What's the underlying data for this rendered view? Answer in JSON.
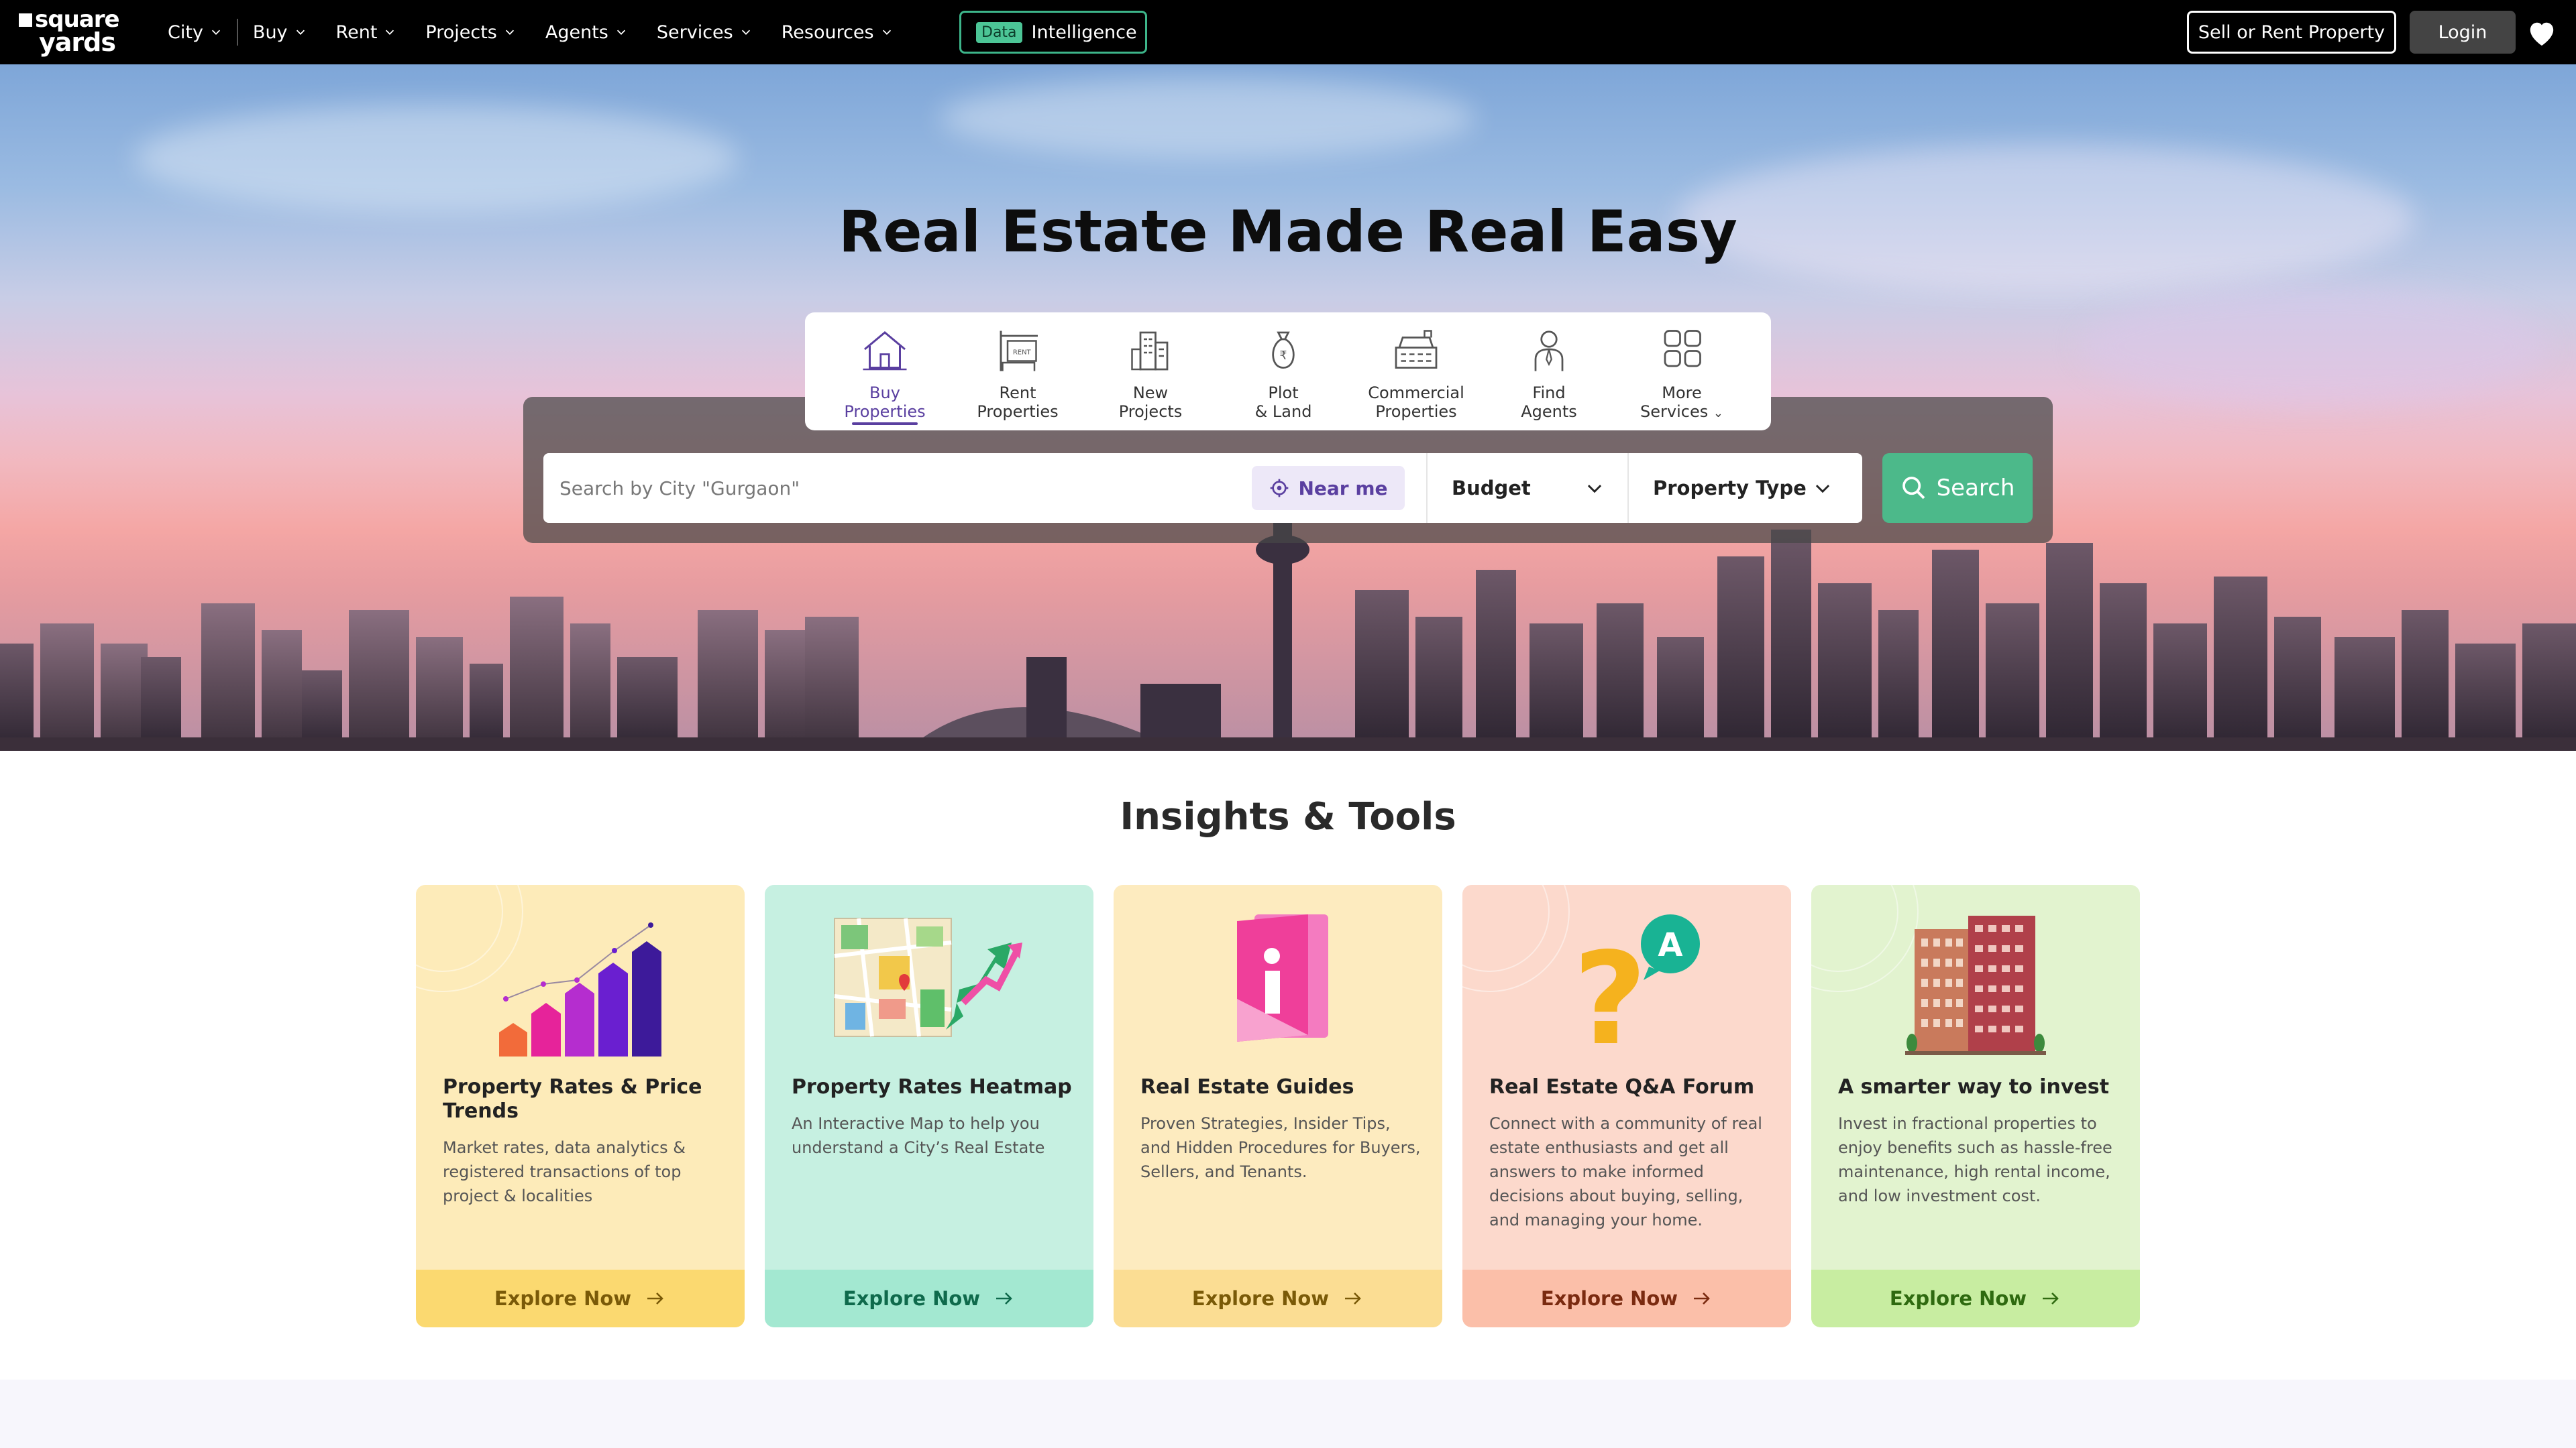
{
  "nav": {
    "logo_line1": "square",
    "logo_line2": "yards",
    "items": [
      {
        "label": "City"
      },
      {
        "label": "Buy"
      },
      {
        "label": "Rent"
      },
      {
        "label": "Projects"
      },
      {
        "label": "Agents"
      },
      {
        "label": "Services"
      },
      {
        "label": "Resources"
      }
    ],
    "data_tag": "Data",
    "data_label": "Intelligence",
    "sell_label": "Sell or Rent Property",
    "login_label": "Login"
  },
  "hero": {
    "title": "Real Estate Made Real Easy"
  },
  "services": [
    {
      "line1": "Buy",
      "line2": "Properties",
      "icon": "house-icon",
      "active": true
    },
    {
      "line1": "Rent",
      "line2": "Properties",
      "icon": "rent-sign-icon"
    },
    {
      "line1": "New",
      "line2": "Projects",
      "icon": "building-icon"
    },
    {
      "line1": "Plot",
      "line2": "& Land",
      "icon": "money-bag-icon"
    },
    {
      "line1": "Commercial",
      "line2": "Properties",
      "icon": "office-icon"
    },
    {
      "line1": "Find",
      "line2": "Agents",
      "icon": "agent-icon"
    },
    {
      "line1": "More",
      "line2": "Services",
      "icon": "grid-icon"
    }
  ],
  "search": {
    "placeholder": "Search by City \"Gurgaon\"",
    "near_me": "Near me",
    "budget": "Budget",
    "property_type": "Property Type",
    "button": "Search"
  },
  "insights": {
    "title": "Insights & Tools",
    "cards": [
      {
        "title": "Property Rates & Price Trends",
        "desc": "Market rates, data analytics & registered transactions of top project & localities",
        "cta": "Explore Now",
        "bg": "#fdebb9",
        "foot": "#fbd970",
        "cta_color": "#7a5a08",
        "icon": "bar-chart-icon"
      },
      {
        "title": "Property Rates Heatmap",
        "desc": "An Interactive Map to help you understand a City’s Real Estate",
        "cta": "Explore Now",
        "bg": "#c6f0e1",
        "foot": "#a3e8d1",
        "cta_color": "#0f6a4c",
        "icon": "heatmap-icon"
      },
      {
        "title": "Real Estate Guides",
        "desc": "Proven Strategies, Insider Tips, and Hidden Procedures for Buyers, Sellers, and Tenants.",
        "cta": "Explore Now",
        "bg": "#fdebbf",
        "foot": "#fbdd93",
        "cta_color": "#7a5a08",
        "icon": "guide-book-icon"
      },
      {
        "title": "Real Estate Q&A Forum",
        "desc": "Connect with a community of real estate enthusiasts and get all answers to make informed decisions about buying, selling, and managing your home.",
        "cta": "Explore Now",
        "bg": "#fcd9cc",
        "foot": "#fbbfa9",
        "cta_color": "#7a2a10",
        "icon": "question-answer-icon"
      },
      {
        "title": "A smarter way to invest",
        "desc": "Invest in fractional properties to enjoy benefits such as hassle-free maintenance, high rental income, and low investment cost.",
        "cta": "Explore Now",
        "bg": "#e2f3cf",
        "foot": "#c8eda1",
        "cta_color": "#2f6a10",
        "icon": "towers-icon"
      }
    ]
  }
}
